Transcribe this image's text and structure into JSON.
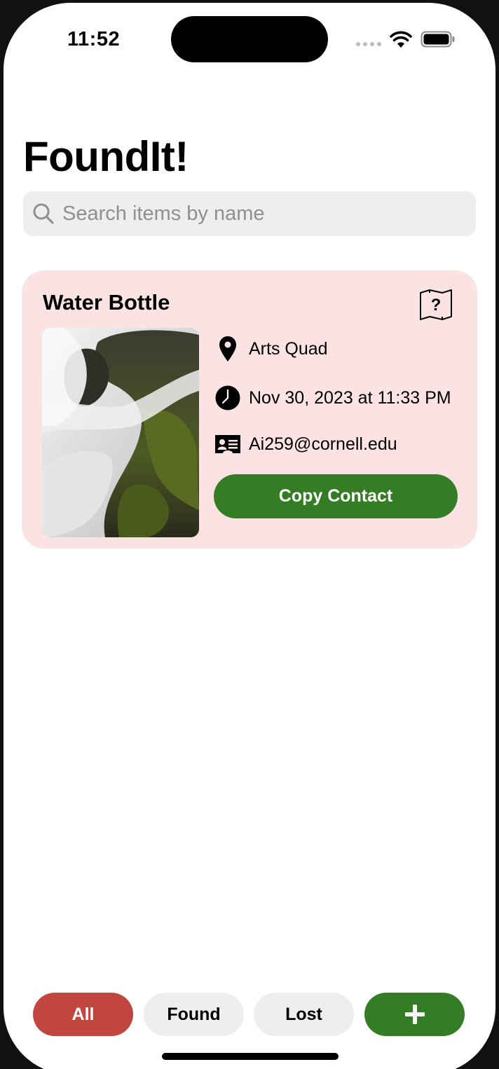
{
  "status_bar": {
    "time": "11:52"
  },
  "header": {
    "title": "FoundIt!"
  },
  "search": {
    "placeholder": "Search items by name",
    "value": ""
  },
  "items": [
    {
      "title": "Water Bottle",
      "location": "Arts Quad",
      "datetime": "Nov 30, 2023 at 11:33 PM",
      "contact": "Ai259@cornell.edu",
      "copy_label": "Copy Contact",
      "icons": {
        "map": "map-question-icon",
        "location": "location-pin-icon",
        "time": "clock-icon",
        "contact": "contact-card-icon"
      }
    }
  ],
  "filters": {
    "all_label": "All",
    "found_label": "Found",
    "lost_label": "Lost",
    "add_label": "+",
    "active": "All"
  },
  "colors": {
    "card_bg": "#fbe3e4",
    "accent_green": "#347d25",
    "active_filter": "#c1463f",
    "inactive_filter": "#eeeeee"
  }
}
